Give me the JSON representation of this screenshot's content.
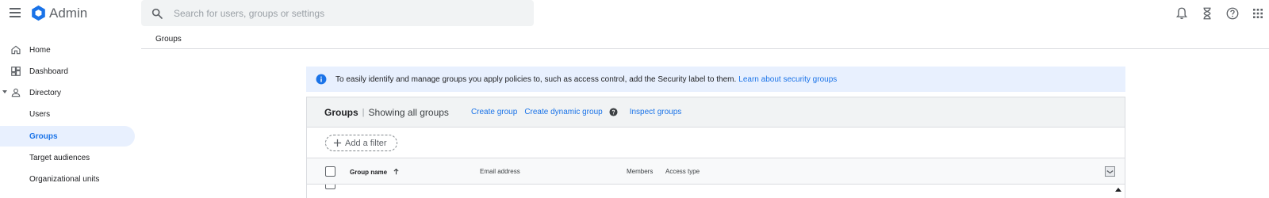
{
  "app": {
    "title": "Admin"
  },
  "search": {
    "placeholder": "Search for users, groups or settings",
    "value": ""
  },
  "top_icons": [
    "bell-icon",
    "hourglass-icon",
    "help-icon",
    "apps-grid-icon"
  ],
  "sidebar": {
    "items": [
      {
        "label": "Home",
        "icon": "home-icon"
      },
      {
        "label": "Dashboard",
        "icon": "dashboard-icon"
      },
      {
        "label": "Directory",
        "icon": "person-icon",
        "expanded": true
      },
      {
        "label": "Users"
      },
      {
        "label": "Groups",
        "selected": true
      },
      {
        "label": "Target audiences"
      },
      {
        "label": "Organizational units"
      }
    ]
  },
  "breadcrumb": {
    "current": "Groups"
  },
  "banner": {
    "text": "To easily identify and manage groups you apply policies to, such as access control, add the Security label to them.",
    "link": "Learn about security groups"
  },
  "panel": {
    "title": "Groups",
    "separator": "|",
    "subtitle": "Showing all groups",
    "actions": {
      "create_group": "Create group",
      "create_dynamic_group": "Create dynamic group",
      "inspect_groups": "Inspect groups"
    },
    "filter_label": "Add a filter",
    "columns": {
      "group_name": "Group name",
      "email_address": "Email address",
      "members": "Members",
      "access_type": "Access type"
    },
    "sort": {
      "column": "Group name",
      "direction": "ascending"
    }
  },
  "colors": {
    "accent": "#1a73e8",
    "selected_bg": "#e8f0fe",
    "banner_bg": "#e8f0fe",
    "panel_header_bg": "#f1f3f4"
  }
}
